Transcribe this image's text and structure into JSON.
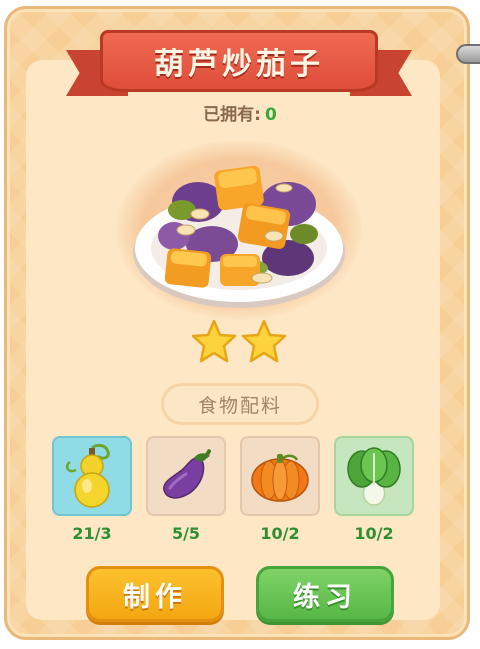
{
  "recipe": {
    "title": "葫芦炒茄子",
    "owned_label": "已拥有:",
    "owned_count": "0",
    "stars": 2
  },
  "ingredients": {
    "label": "食物配料",
    "items": [
      {
        "icon": "gourd-icon",
        "count": "21/3",
        "bg": "#8fdce6"
      },
      {
        "icon": "eggplant-icon",
        "count": "5/5",
        "bg": "#f2dcc4"
      },
      {
        "icon": "pumpkin-icon",
        "count": "10/2",
        "bg": "#f2dcc4"
      },
      {
        "icon": "bok-choy-icon",
        "count": "10/2",
        "bg": "#c6e6c0"
      }
    ]
  },
  "actions": {
    "make_label": "制作",
    "practice_label": "练习"
  },
  "colors": {
    "ribbon": "#de4e3a",
    "make_button": "#f3a712",
    "practice_button": "#57b846",
    "count_green": "#2f8d33"
  }
}
